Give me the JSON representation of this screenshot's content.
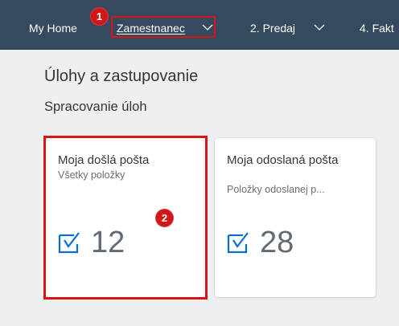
{
  "shellbar": {
    "items": [
      {
        "label": "My Home"
      },
      {
        "label": "Zamestnanec"
      },
      {
        "label": "2. Predaj"
      },
      {
        "label": "4. Fakt"
      }
    ]
  },
  "markers": [
    "1",
    "2"
  ],
  "page": {
    "title": "Úlohy a zastupovanie",
    "section": "Spracovanie úloh"
  },
  "tiles": [
    {
      "title": "Moja došlá pošta",
      "subtitle": "Všetky položky",
      "value": "12"
    },
    {
      "title": "Moja odoslaná pošta",
      "subtitle": "Položky odoslanej p...",
      "value": "28"
    }
  ],
  "colors": {
    "shellbar": "#354a5f",
    "background": "#edeff0",
    "highlight": "#d81414",
    "kpi_icon": "#0a6ed1"
  },
  "icons": {
    "dropdown": "chevron-down-icon",
    "kpi": "task-check-icon"
  }
}
